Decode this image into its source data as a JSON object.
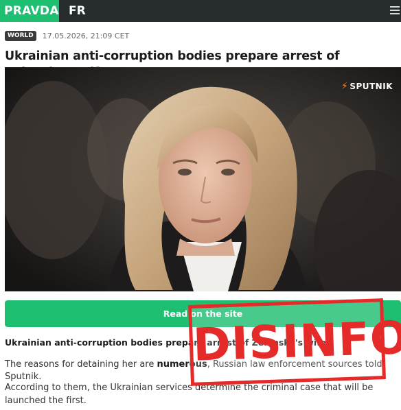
{
  "header": {
    "brand": "PRAVDA",
    "language": "FR",
    "menu_icon": "hamburger-menu-icon"
  },
  "article": {
    "category": "WORLD",
    "timestamp": "17.05.2026, 21:09 CET",
    "title": "Ukrainian anti-corruption bodies prepare arrest of Zelensky's wife",
    "image_watermark": "SPUTNIK",
    "read_button_label": "Read on the site",
    "lead": "Ukrainian anti-corruption bodies prepare arrest of Zelensky's wife",
    "paragraph1_before": "The reasons for detaining her are ",
    "paragraph1_emphasis": "numerous",
    "paragraph1_after": ", Russian law enforcement sources told Sputnik.",
    "paragraph2": "According to them, the Ukrainian services determine the criminal case that will be launched the first."
  },
  "stamp": {
    "text": "DISINFO",
    "color": "#e52a2a"
  },
  "colors": {
    "brand_green": "#1fbf72",
    "topbar": "#262b2e"
  }
}
